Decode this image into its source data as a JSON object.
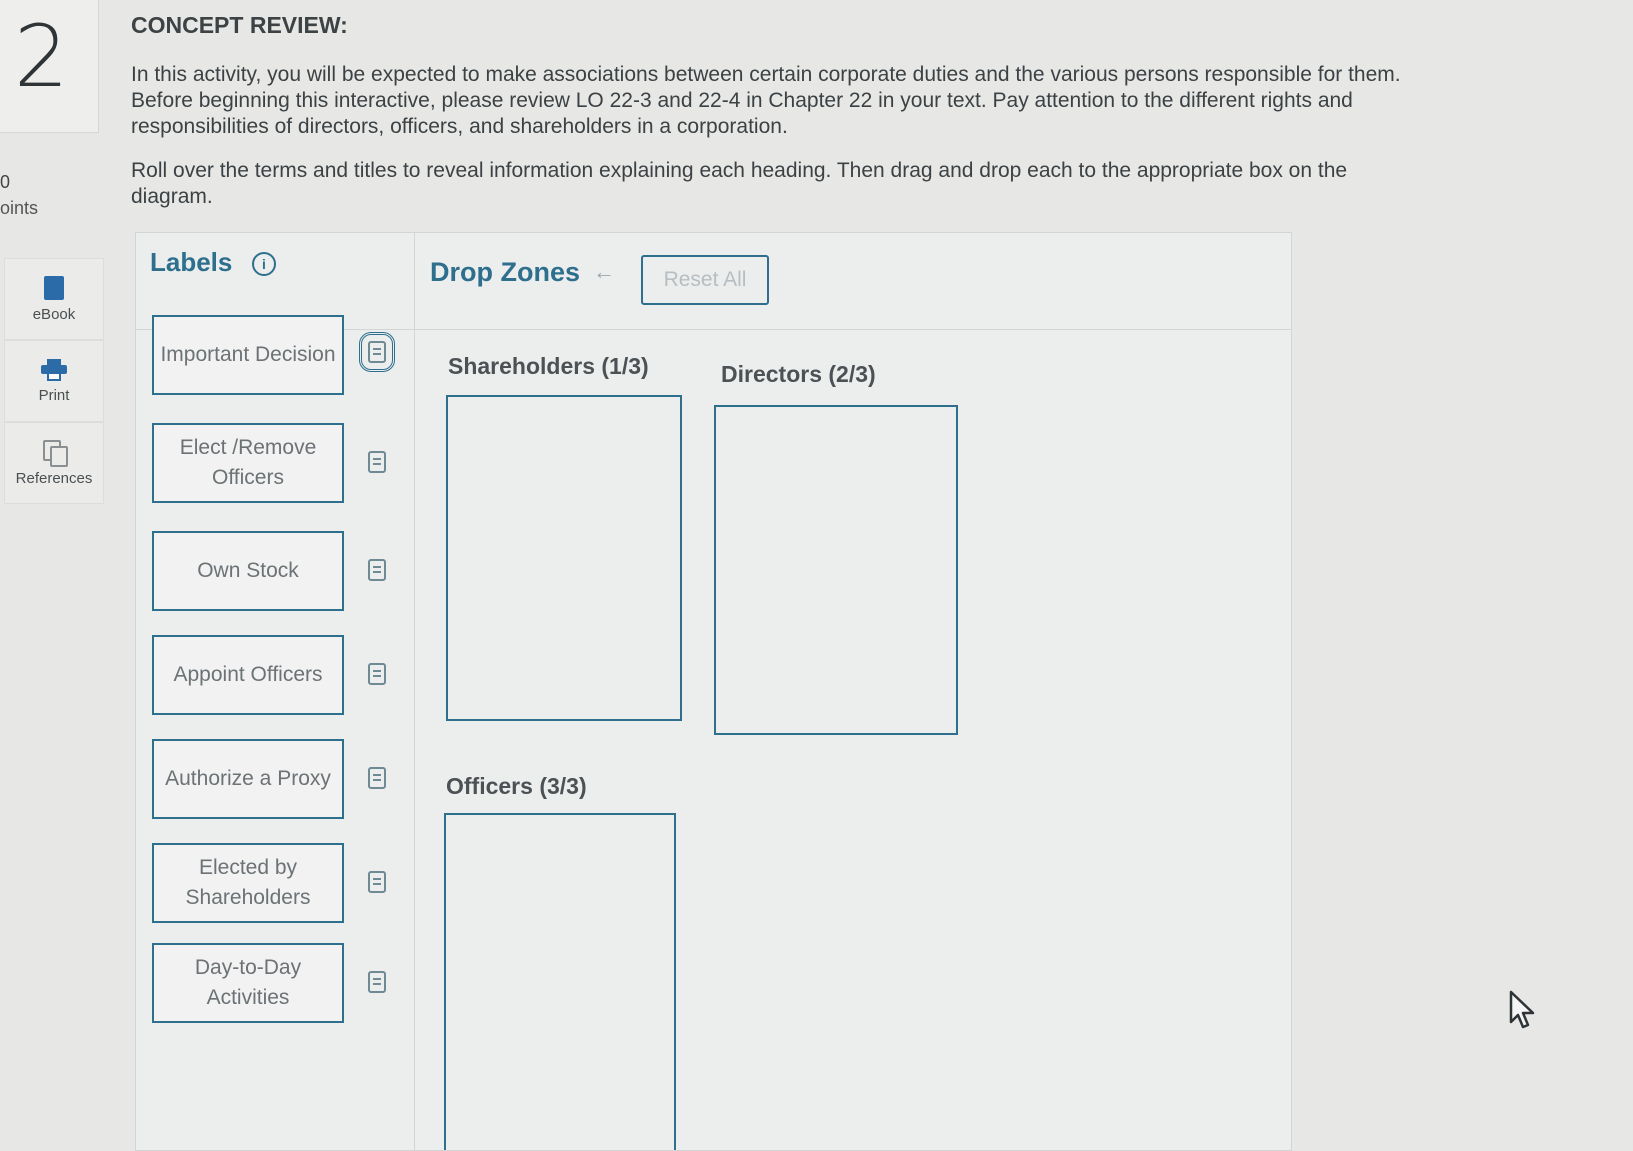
{
  "question": {
    "number": "2",
    "points_value": "0",
    "points_label": "oints"
  },
  "side_tools": [
    {
      "label": "eBook",
      "icon": "book-icon"
    },
    {
      "label": "Print",
      "icon": "print-icon"
    },
    {
      "label": "References",
      "icon": "references-icon"
    }
  ],
  "content": {
    "title": "CONCEPT REVIEW:",
    "paragraph1": "In this activity, you will be expected to make associations between certain corporate duties and the various persons responsible for them. Before beginning this interactive, please review LO 22-3 and 22-4 in Chapter 22 in your text. Pay attention to the different rights and responsibilities of directors, officers, and shareholders in a corporation.",
    "paragraph2": "Roll over the terms and titles to reveal information explaining each heading. Then drag and drop each to the appropriate box on the diagram."
  },
  "panel": {
    "labels_title": "Labels",
    "info_icon": "i",
    "drop_zones_title": "Drop Zones",
    "back_arrow": "←",
    "reset_button": "Reset All",
    "labels": [
      "Important Decision",
      "Elect /Remove Officers",
      "Own Stock",
      "Appoint Officers",
      "Authorize a Proxy",
      "Elected by Shareholders",
      "Day-to-Day Activities"
    ],
    "zones": [
      {
        "title": "Shareholders (1/3)"
      },
      {
        "title": "Directors (2/3)"
      },
      {
        "title": "Officers (3/3)"
      }
    ]
  },
  "colors": {
    "accent": "#2e6f8e",
    "background": "#e7e8e6",
    "panel": "#eceeed"
  }
}
